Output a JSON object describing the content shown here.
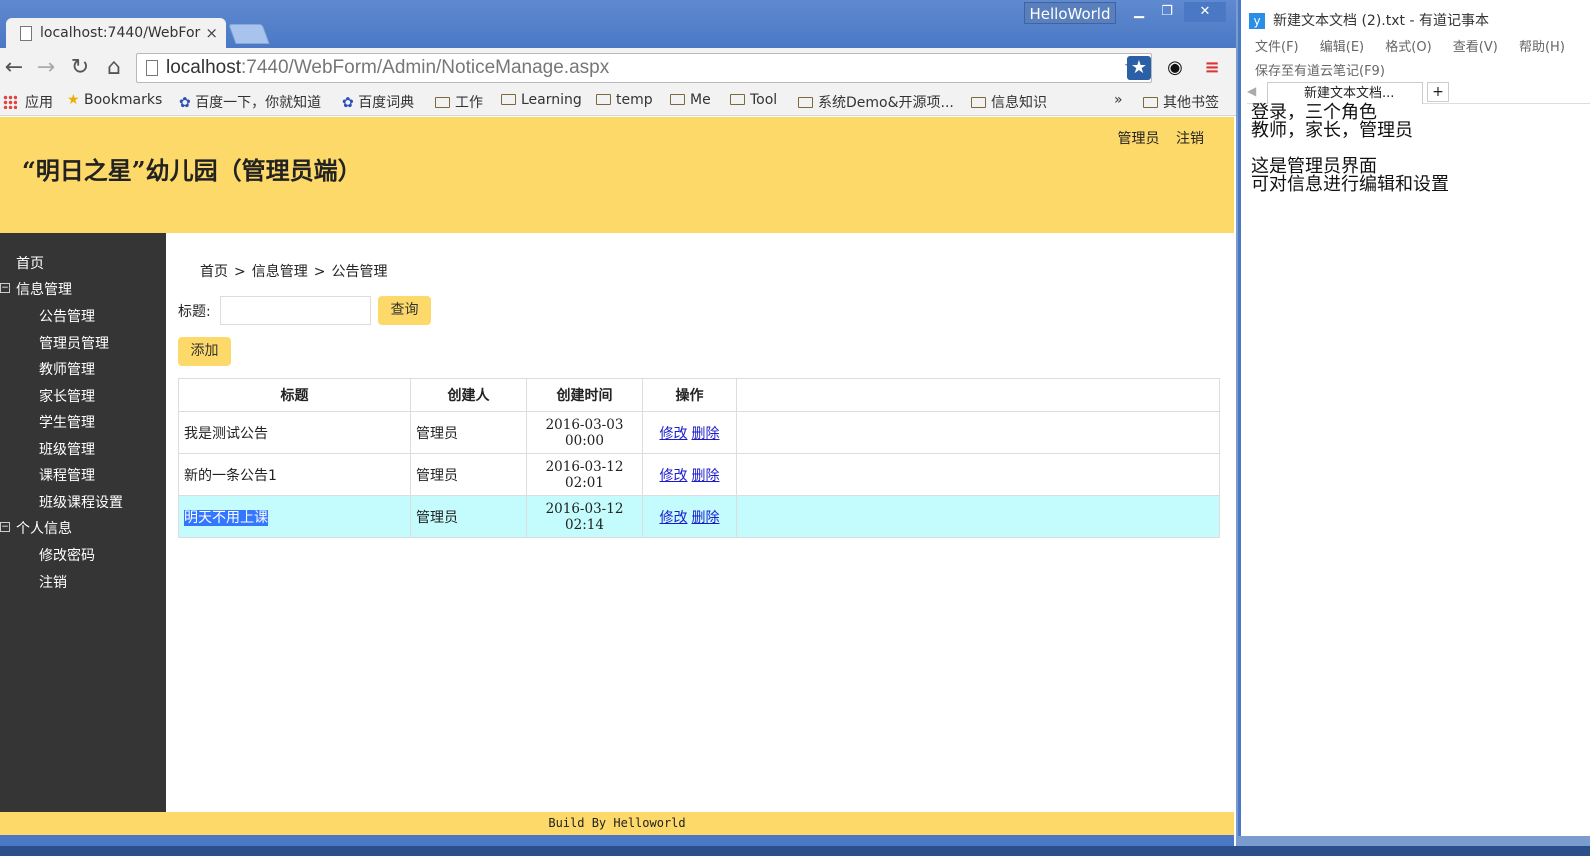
{
  "browser": {
    "tab_title": "localhost:7440/WebFor",
    "tab_close": "×",
    "window_label": "HelloWorld",
    "url_host": "localhost",
    "url_rest": ":7440/WebForm/Admin/NoticeManage.aspx",
    "bookmarks": [
      "应用",
      "Bookmarks",
      "百度一下，你就知道",
      "百度词典",
      "工作",
      "Learning",
      "temp",
      "Me",
      "Tool",
      "系统Demo&开源项...",
      "信息知识"
    ],
    "bookmarks_more": "»",
    "other_bookmarks": "其他书签"
  },
  "header": {
    "title": "“明日之星”幼儿园（管理员端）",
    "user": "管理员",
    "logout": "注销"
  },
  "sidebar": {
    "home": "首页",
    "info_group": "信息管理",
    "info_items": [
      "公告管理",
      "管理员管理",
      "教师管理",
      "家长管理",
      "学生管理",
      "班级管理",
      "课程管理",
      "班级课程设置"
    ],
    "personal_group": "个人信息",
    "personal_items": [
      "修改密码",
      "注销"
    ]
  },
  "breadcrumb": [
    "首页",
    "信息管理",
    "公告管理"
  ],
  "breadcrumb_sep": ">",
  "search": {
    "label": "标题:",
    "value": "",
    "query_button": "查询"
  },
  "add_button": "添加",
  "table": {
    "headers": [
      "标题",
      "创建人",
      "创建时间",
      "操作"
    ],
    "rows": [
      {
        "title": "我是测试公告",
        "creator": "管理员",
        "date": "2016-03-03",
        "time": "00:00",
        "edit": "修改",
        "delete": "删除"
      },
      {
        "title": "新的一条公告1",
        "creator": "管理员",
        "date": "2016-03-12",
        "time": "02:01",
        "edit": "修改",
        "delete": "删除"
      },
      {
        "title": "明天不用上课",
        "creator": "管理员",
        "date": "2016-03-12",
        "time": "02:14",
        "edit": "修改",
        "delete": "删除"
      }
    ]
  },
  "footer": "Build By Helloworld",
  "notepad": {
    "title": "新建文本文档 (2).txt - 有道记事本",
    "menu": [
      "文件(F)",
      "编辑(E)",
      "格式(O)",
      "查看(V)",
      "帮助(H)"
    ],
    "save_link": "保存至有道云笔记(F9)",
    "tab": "新建文本文档...",
    "plus": "+",
    "lines": [
      "登录，三个角色",
      "教师，家长，管理员",
      "",
      "这是管理员界面",
      "可对信息进行编辑和设置"
    ]
  }
}
